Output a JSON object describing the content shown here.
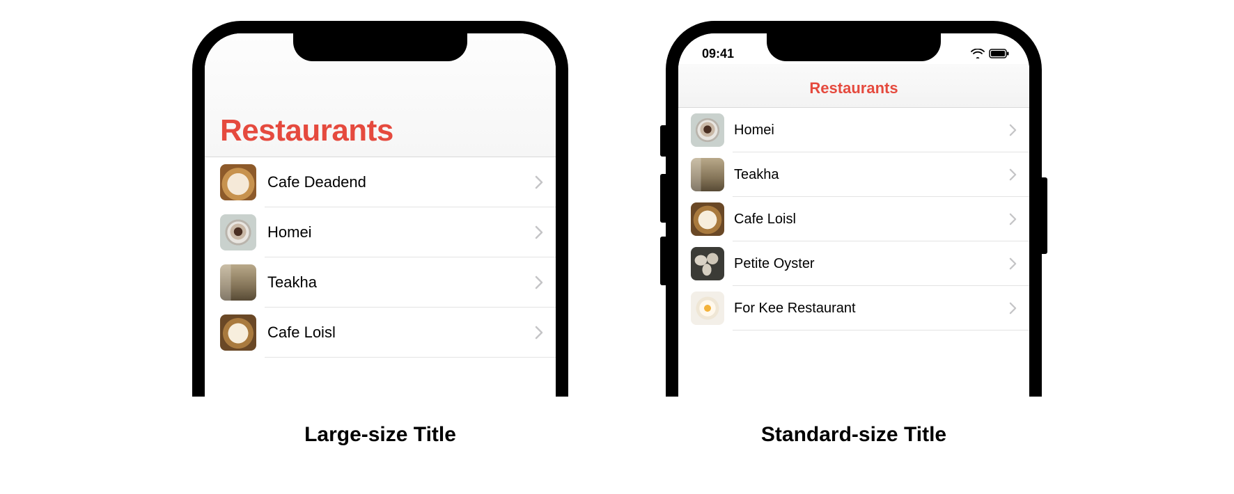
{
  "accent_color": "#e54a3e",
  "left": {
    "caption": "Large-size Title",
    "header_title": "Restaurants",
    "rows": [
      {
        "label": "Cafe Deadend",
        "thumb": "t-latte-heart"
      },
      {
        "label": "Homei",
        "thumb": "t-espresso"
      },
      {
        "label": "Teakha",
        "thumb": "t-press"
      },
      {
        "label": "Cafe Loisl",
        "thumb": "t-latte-art"
      }
    ]
  },
  "right": {
    "caption": "Standard-size Title",
    "status_time": "09:41",
    "nav_title": "Restaurants",
    "rows": [
      {
        "label": "Homei",
        "thumb": "t-espresso"
      },
      {
        "label": "Teakha",
        "thumb": "t-press"
      },
      {
        "label": "Cafe Loisl",
        "thumb": "t-latte-art"
      },
      {
        "label": "Petite Oyster",
        "thumb": "t-oyster"
      },
      {
        "label": "For Kee Restaurant",
        "thumb": "t-egg"
      }
    ]
  }
}
